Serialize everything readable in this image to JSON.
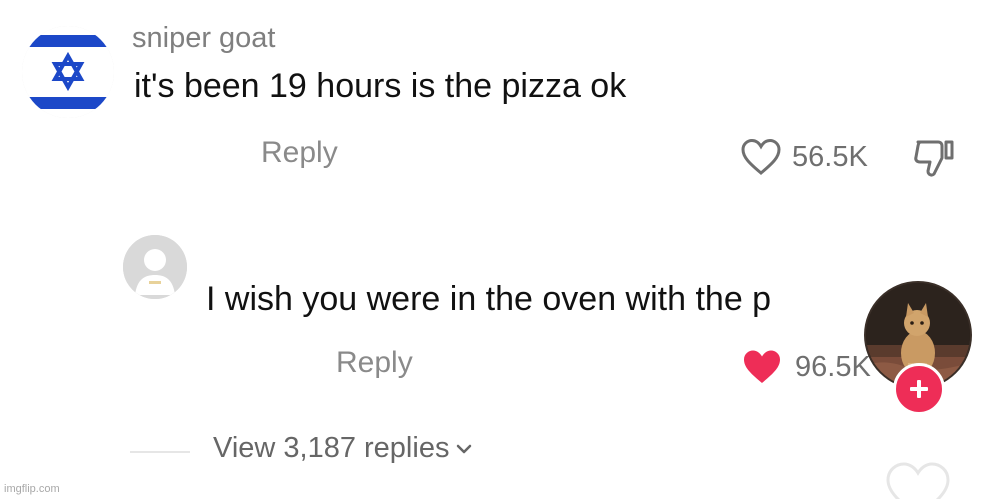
{
  "comment": {
    "username": "sniper goat",
    "avatar_icon": "israel-flag-icon",
    "text": "it's been 19 hours is the pizza ok",
    "reply_label": "Reply",
    "likes": "56.5K",
    "liked": false
  },
  "reply_comment": {
    "avatar_icon": "default-user-avatar-icon",
    "text": "I wish you were in the oven with the p",
    "reply_label": "Reply",
    "likes": "96.5K",
    "liked": true,
    "like_color": "#ee2d57"
  },
  "creator": {
    "avatar_icon": "cat-photo-avatar-icon",
    "follow_icon": "plus-icon",
    "follow_color": "#ee2d57"
  },
  "view_replies": {
    "label": "View 3,187 replies",
    "icon": "chevron-down-icon"
  },
  "watermark": "imgflip.com"
}
